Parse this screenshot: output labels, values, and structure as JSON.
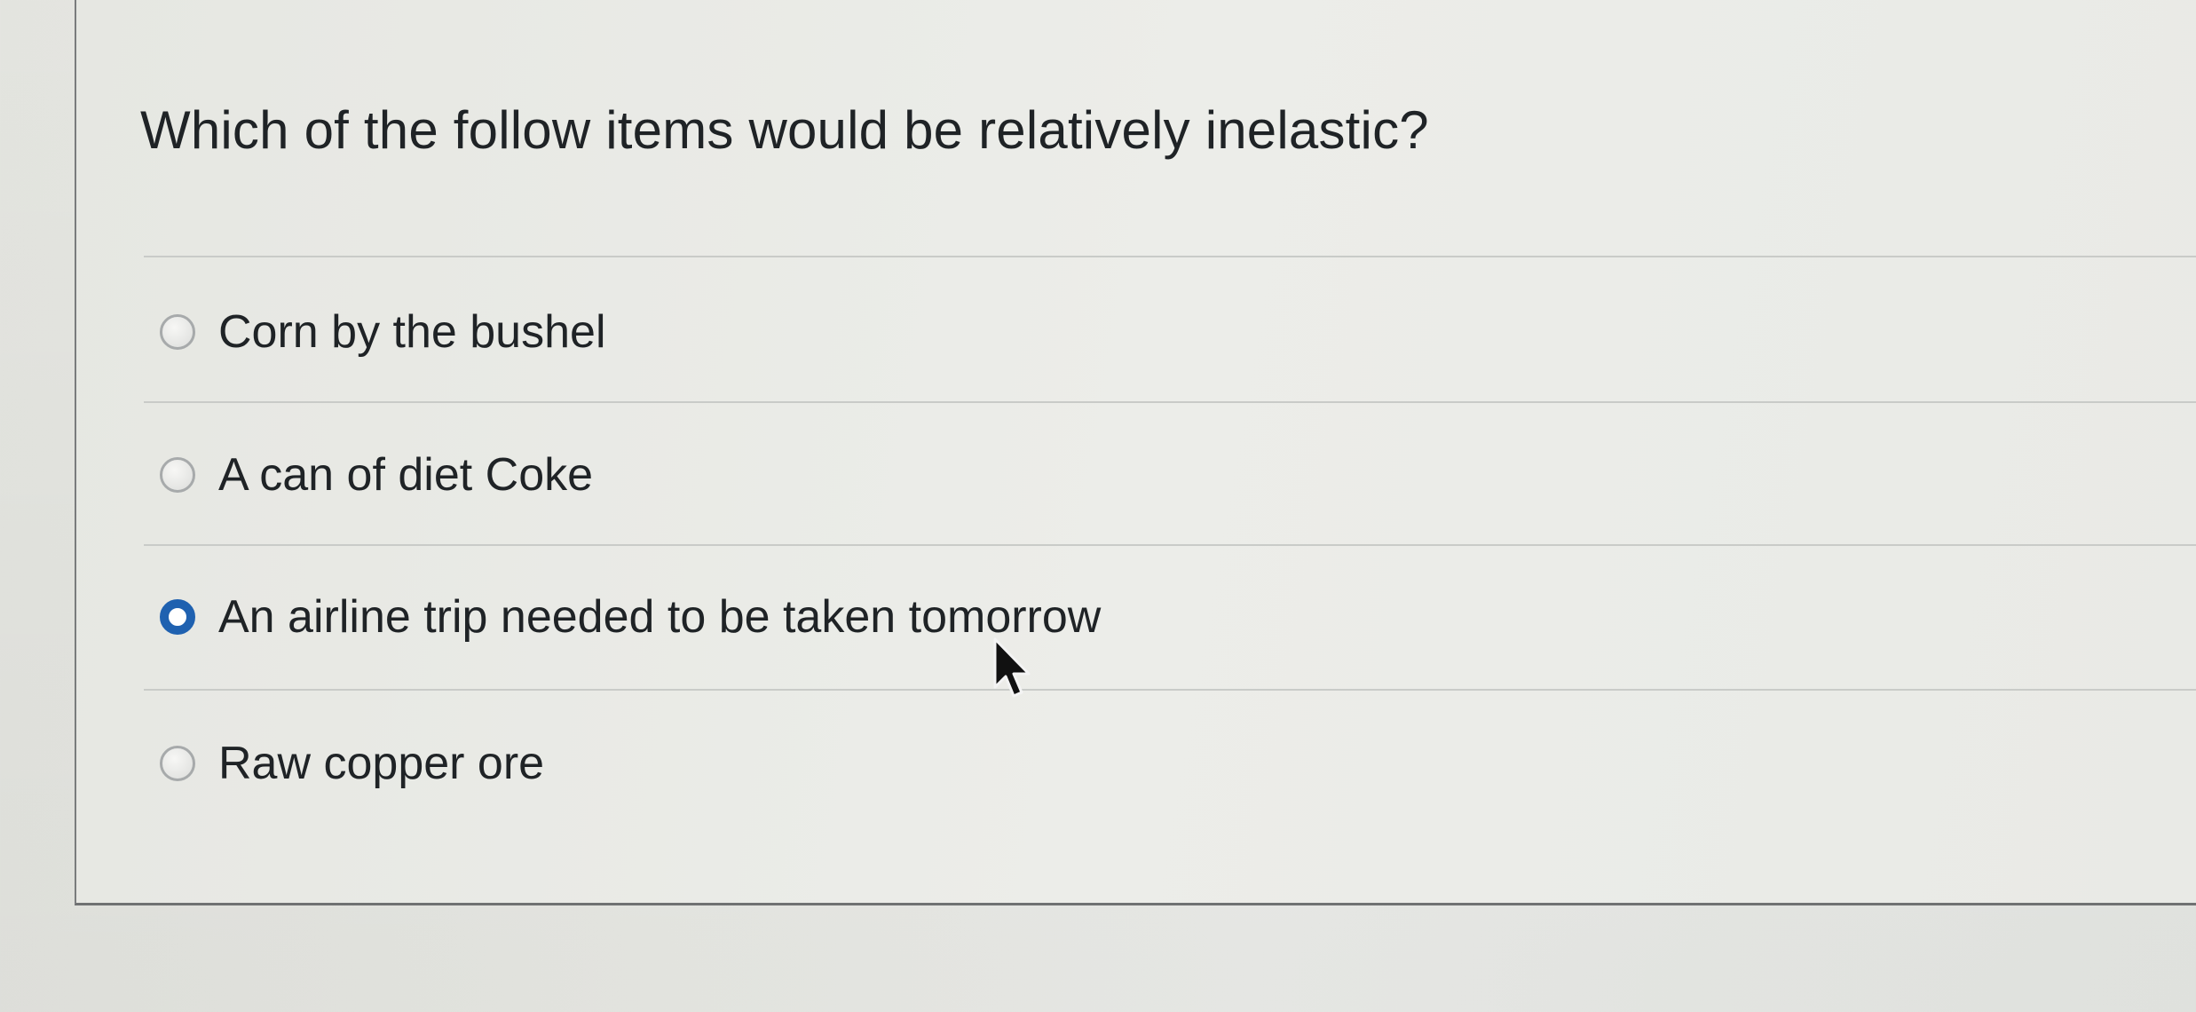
{
  "question": {
    "text": "Which of the follow items would be relatively inelastic?"
  },
  "options": [
    {
      "label": "Corn by the bushel",
      "selected": false
    },
    {
      "label": "A can of diet Coke",
      "selected": false
    },
    {
      "label": "An airline trip needed to be taken tomorrow",
      "selected": true
    },
    {
      "label": "Raw copper ore",
      "selected": false
    }
  ],
  "colors": {
    "selected_radio": "#1f61b0",
    "text": "#1f2326"
  },
  "icons": {
    "pointer": "mouse-pointer-icon"
  }
}
